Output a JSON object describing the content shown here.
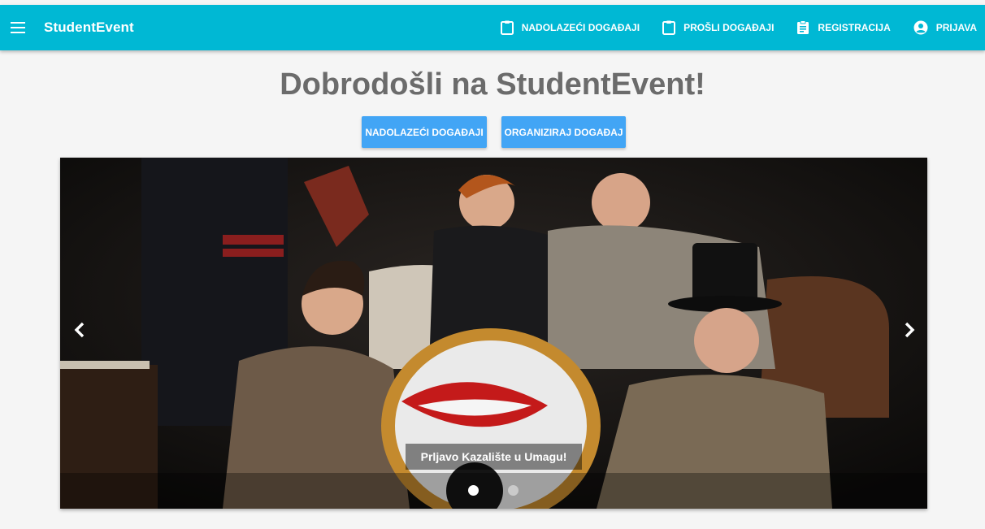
{
  "appbar": {
    "menu_icon": "hamburger-menu-icon",
    "brand": "StudentEvent",
    "nav": [
      {
        "label": "NADOLAZEĆI DOGAĐAJI",
        "icon": "clipboard-icon"
      },
      {
        "label": "PROŠLI DOGAĐAJI",
        "icon": "clipboard-icon"
      },
      {
        "label": "REGISTRACIJA",
        "icon": "clipboard-text-icon"
      },
      {
        "label": "PRIJAVA",
        "icon": "account-circle-icon"
      }
    ]
  },
  "main": {
    "title": "Dobrodošli na StudentEvent!",
    "buttons": {
      "upcoming": "NADOLAZEĆI DOGAĐAJI",
      "organize": "ORGANIZIRAJ DOGAĐAJ"
    }
  },
  "carousel": {
    "caption": "Prljavo Kazalište u Umagu!",
    "slide_count": 2,
    "active_slide": 1,
    "prev_icon": "chevron-left-icon",
    "next_icon": "chevron-right-icon"
  },
  "colors": {
    "appbar": "#00b8d4",
    "button": "#42a5f5",
    "title": "#6b6b6b",
    "background": "#f5f5f5"
  }
}
